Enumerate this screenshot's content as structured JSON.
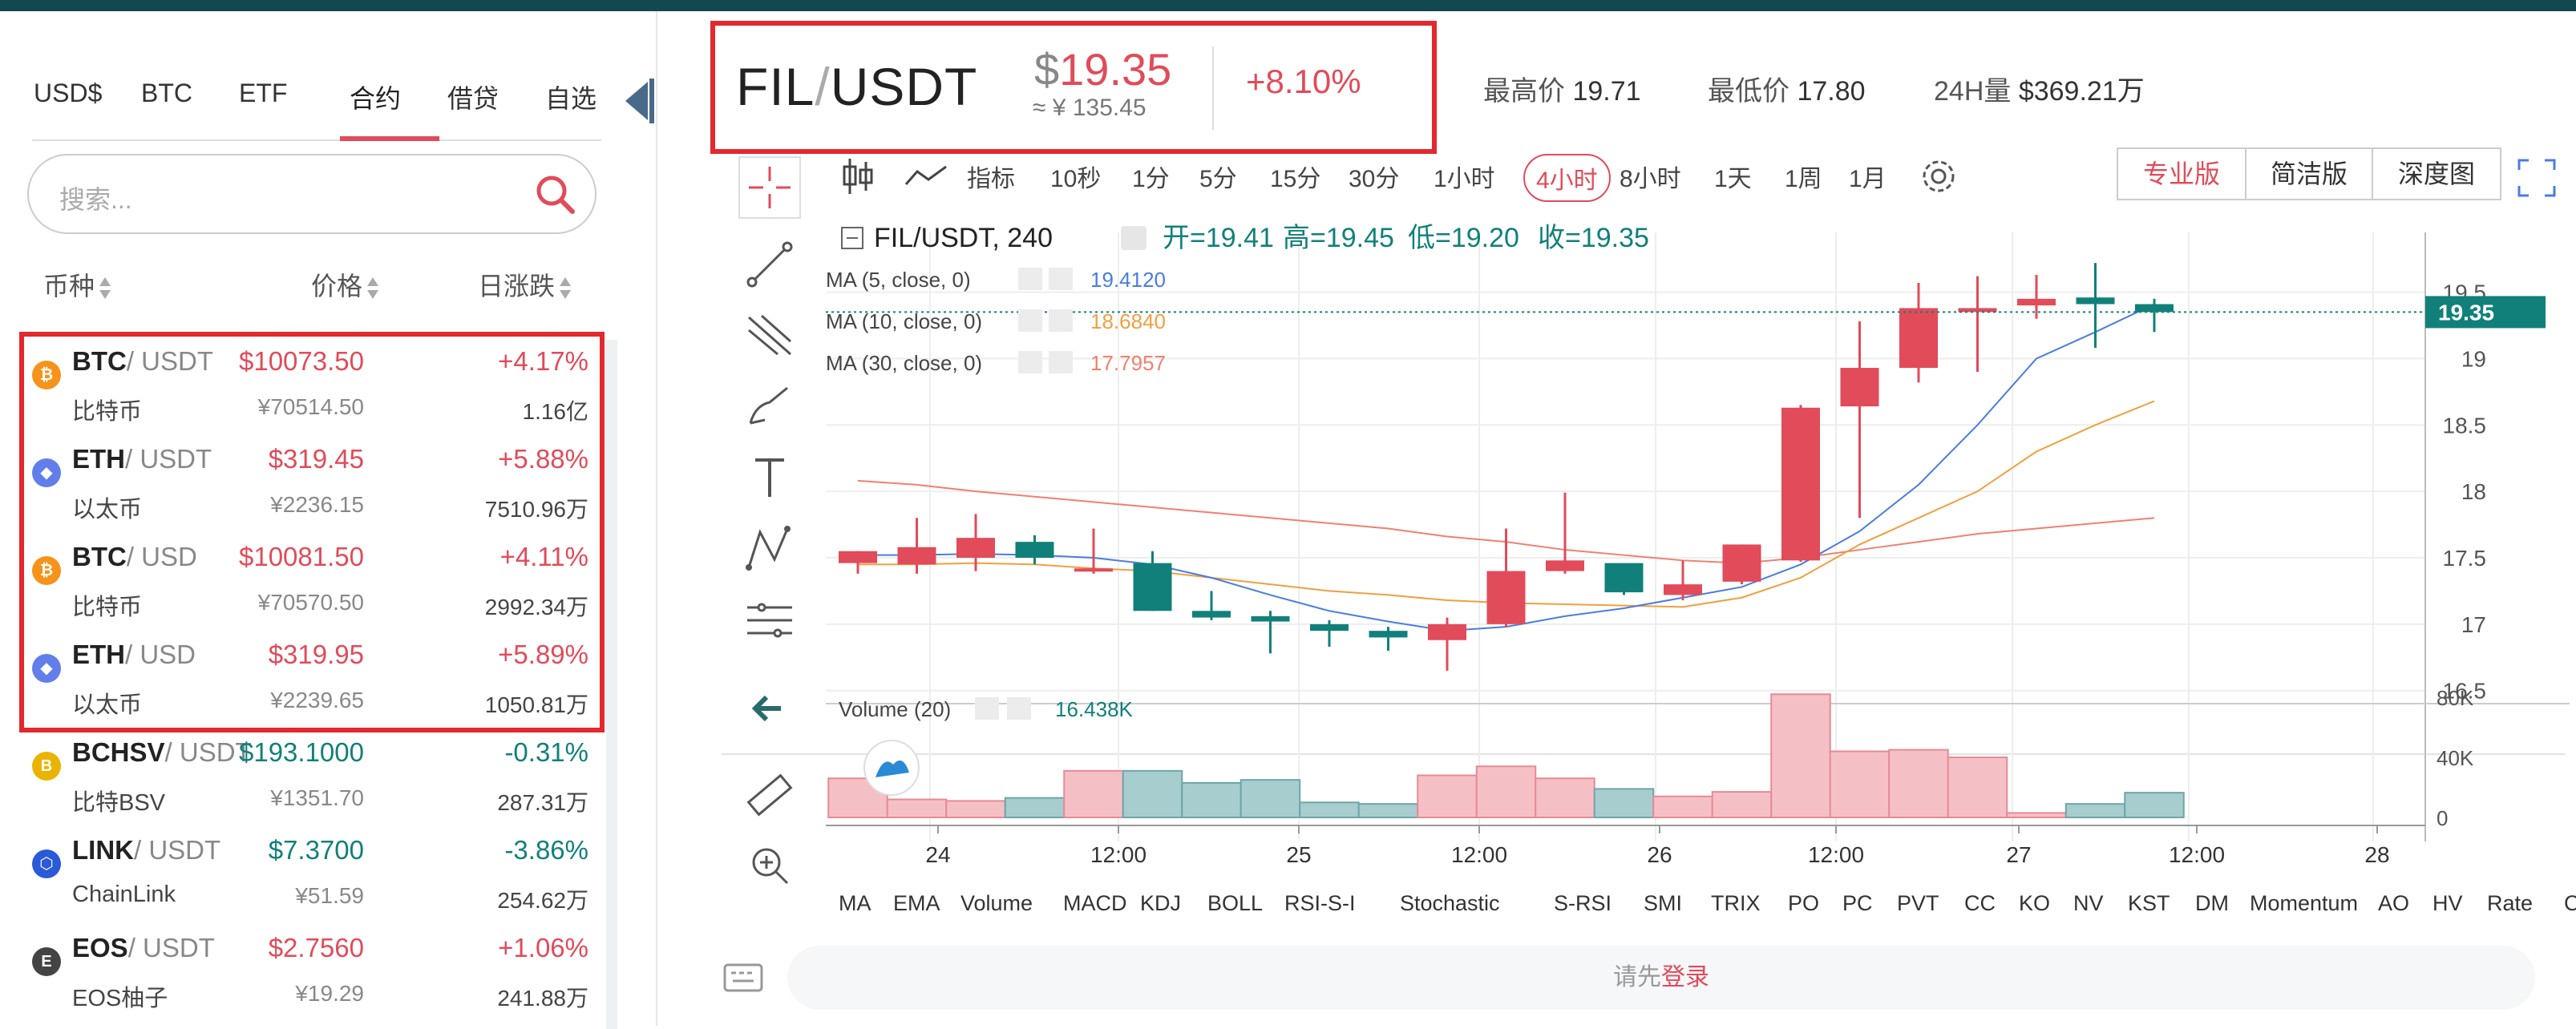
{
  "left_tabs": [
    "USD$",
    "BTC",
    "ETF",
    "合约",
    "借贷",
    "自选"
  ],
  "search_placeholder": "搜索...",
  "columns": {
    "coin": "币种",
    "price": "价格",
    "change": "日涨跌"
  },
  "markets": [
    {
      "sym": "BTC",
      "quote": "/ USDT",
      "cn": "比特币",
      "price": "$10073.50",
      "cny": "¥70514.50",
      "change": "+4.17%",
      "vol": "1.16亿",
      "dir": "up",
      "color": "#f7931a",
      "glyph": "₿"
    },
    {
      "sym": "ETH",
      "quote": "/ USDT",
      "cn": "以太币",
      "price": "$319.45",
      "cny": "¥2236.15",
      "change": "+5.88%",
      "vol": "7510.96万",
      "dir": "up",
      "color": "#627eea",
      "glyph": "◆"
    },
    {
      "sym": "BTC",
      "quote": "/ USD",
      "cn": "比特币",
      "price": "$10081.50",
      "cny": "¥70570.50",
      "change": "+4.11%",
      "vol": "2992.34万",
      "dir": "up",
      "color": "#f7931a",
      "glyph": "₿"
    },
    {
      "sym": "ETH",
      "quote": "/ USD",
      "cn": "以太币",
      "price": "$319.95",
      "cny": "¥2239.65",
      "change": "+5.89%",
      "vol": "1050.81万",
      "dir": "up",
      "color": "#627eea",
      "glyph": "◆"
    },
    {
      "sym": "BCHSV",
      "quote": "/ USDT",
      "cn": "比特BSV",
      "price": "$193.1000",
      "cny": "¥1351.70",
      "change": "-0.31%",
      "vol": "287.31万",
      "dir": "dn",
      "color": "#eab300",
      "glyph": "B"
    },
    {
      "sym": "LINK",
      "quote": "/ USDT",
      "cn": "ChainLink",
      "price": "$7.3700",
      "cny": "¥51.59",
      "change": "-3.86%",
      "vol": "254.62万",
      "dir": "dn",
      "color": "#2a5ada",
      "glyph": "⬡"
    },
    {
      "sym": "EOS",
      "quote": "/ USDT",
      "cn": "EOS柚子",
      "price": "$2.7560",
      "cny": "¥19.29",
      "change": "+1.06%",
      "vol": "241.88万",
      "dir": "up",
      "color": "#444444",
      "glyph": "E"
    }
  ],
  "header": {
    "base": "FIL",
    "sep": "/",
    "quote": "USDT",
    "dollar": "$",
    "price": "19.35",
    "approx": "≈ ¥ 135.45",
    "pct": "+8.10%",
    "high_label": "最高价",
    "high": "19.71",
    "low_label": "最低价",
    "low": "17.80",
    "vol_label": "24H量",
    "vol": "$369.21万"
  },
  "toolbar": {
    "indicators": "指标",
    "intervals": [
      "10秒",
      "1分",
      "5分",
      "15分",
      "30分",
      "1小时",
      "4小时",
      "8小时",
      "1天",
      "1周",
      "1月"
    ],
    "active": "4小时"
  },
  "views": [
    "专业版",
    "简洁版",
    "深度图"
  ],
  "chart_info": {
    "title": "FIL/USDT, 240",
    "open": "开=19.41",
    "high": "高=19.45",
    "low": "低=19.20",
    "close": "收=19.35",
    "ma5": "MA (5, close, 0)",
    "ma5v": "19.4120",
    "ma10": "MA (10, close, 0)",
    "ma10v": "18.6840",
    "ma30": "MA (30, close, 0)",
    "ma30v": "17.7957",
    "vol_label": "Volume (20)",
    "vol_value": "16.438K",
    "last_price": "19.35"
  },
  "indicators": [
    "MA",
    "EMA",
    "Volume",
    "MACD",
    "KDJ",
    "BOLL",
    "RSI-S-I",
    "Stochastic",
    "S-RSI",
    "SMI",
    "TRIX",
    "PO",
    "PC",
    "PVT",
    "CC",
    "KO",
    "NV",
    "KST",
    "DM",
    "Momentum",
    "AO",
    "HV",
    "Rate",
    "CCI"
  ],
  "login": {
    "pre": "请先",
    "link": "登录"
  },
  "colors": {
    "up": "#e14b5a",
    "down": "#11807a",
    "ma5": "#4a7de0",
    "ma10": "#f0a040",
    "ma30": "#f08070"
  },
  "chart_data": {
    "type": "candlestick",
    "title": "FIL/USDT, 240",
    "yticks": [
      16.5,
      17.0,
      17.5,
      18.0,
      18.5,
      19.0,
      19.5
    ],
    "ylim": [
      16.45,
      19.95
    ],
    "xticks": [
      "24",
      "12:00",
      "25",
      "12:00",
      "26",
      "12:00",
      "27",
      "12:00",
      "28"
    ],
    "candles": [
      {
        "o": 17.46,
        "h": 17.55,
        "l": 17.38,
        "c": 17.55
      },
      {
        "o": 17.45,
        "h": 17.8,
        "l": 17.38,
        "c": 17.58
      },
      {
        "o": 17.5,
        "h": 17.83,
        "l": 17.4,
        "c": 17.65
      },
      {
        "o": 17.62,
        "h": 17.67,
        "l": 17.45,
        "c": 17.5
      },
      {
        "o": 17.42,
        "h": 17.72,
        "l": 17.38,
        "c": 17.42
      },
      {
        "o": 17.46,
        "h": 17.55,
        "l": 17.1,
        "c": 17.1
      },
      {
        "o": 17.1,
        "h": 17.25,
        "l": 17.03,
        "c": 17.05
      },
      {
        "o": 17.06,
        "h": 17.1,
        "l": 16.78,
        "c": 17.02
      },
      {
        "o": 17.0,
        "h": 17.03,
        "l": 16.83,
        "c": 16.95
      },
      {
        "o": 16.95,
        "h": 16.98,
        "l": 16.8,
        "c": 16.9
      },
      {
        "o": 16.88,
        "h": 17.05,
        "l": 16.65,
        "c": 17.0
      },
      {
        "o": 17.0,
        "h": 17.72,
        "l": 16.98,
        "c": 17.4
      },
      {
        "o": 17.4,
        "h": 17.99,
        "l": 17.38,
        "c": 17.48
      },
      {
        "o": 17.46,
        "h": 17.45,
        "l": 17.22,
        "c": 17.24
      },
      {
        "o": 17.22,
        "h": 17.48,
        "l": 17.18,
        "c": 17.3
      },
      {
        "o": 17.32,
        "h": 17.6,
        "l": 17.3,
        "c": 17.6
      },
      {
        "o": 17.48,
        "h": 18.65,
        "l": 17.47,
        "c": 18.63
      },
      {
        "o": 18.64,
        "h": 19.28,
        "l": 17.8,
        "c": 18.93
      },
      {
        "o": 18.93,
        "h": 19.57,
        "l": 18.82,
        "c": 19.38
      },
      {
        "o": 19.35,
        "h": 19.62,
        "l": 18.9,
        "c": 19.38
      },
      {
        "o": 19.4,
        "h": 19.63,
        "l": 19.3,
        "c": 19.45
      },
      {
        "o": 19.46,
        "h": 19.72,
        "l": 19.08,
        "c": 19.41
      },
      {
        "o": 19.41,
        "h": 19.45,
        "l": 19.2,
        "c": 19.35
      }
    ],
    "volume": [
      26000,
      12000,
      11000,
      13000,
      31000,
      31000,
      23000,
      25000,
      10000,
      9000,
      28000,
      34000,
      26000,
      19000,
      14000,
      17000,
      82000,
      44000,
      45000,
      40000,
      3000,
      9000,
      16438
    ],
    "volume_yticks": [
      "0",
      "40K",
      "80K"
    ],
    "ma5": [
      17.52,
      17.52,
      17.53,
      17.52,
      17.5,
      17.45,
      17.35,
      17.22,
      17.1,
      17.02,
      16.95,
      16.98,
      17.06,
      17.12,
      17.2,
      17.28,
      17.45,
      17.7,
      18.05,
      18.5,
      19.0,
      19.2,
      19.41
    ],
    "ma10": [
      17.45,
      17.45,
      17.46,
      17.45,
      17.42,
      17.4,
      17.35,
      17.3,
      17.25,
      17.22,
      17.18,
      17.16,
      17.15,
      17.14,
      17.13,
      17.2,
      17.35,
      17.6,
      17.8,
      18.0,
      18.3,
      18.5,
      18.68
    ],
    "ma30": [
      18.08,
      18.05,
      18.0,
      17.96,
      17.92,
      17.88,
      17.84,
      17.8,
      17.76,
      17.72,
      17.66,
      17.62,
      17.56,
      17.52,
      17.48,
      17.46,
      17.5,
      17.56,
      17.62,
      17.68,
      17.72,
      17.76,
      17.8
    ]
  }
}
